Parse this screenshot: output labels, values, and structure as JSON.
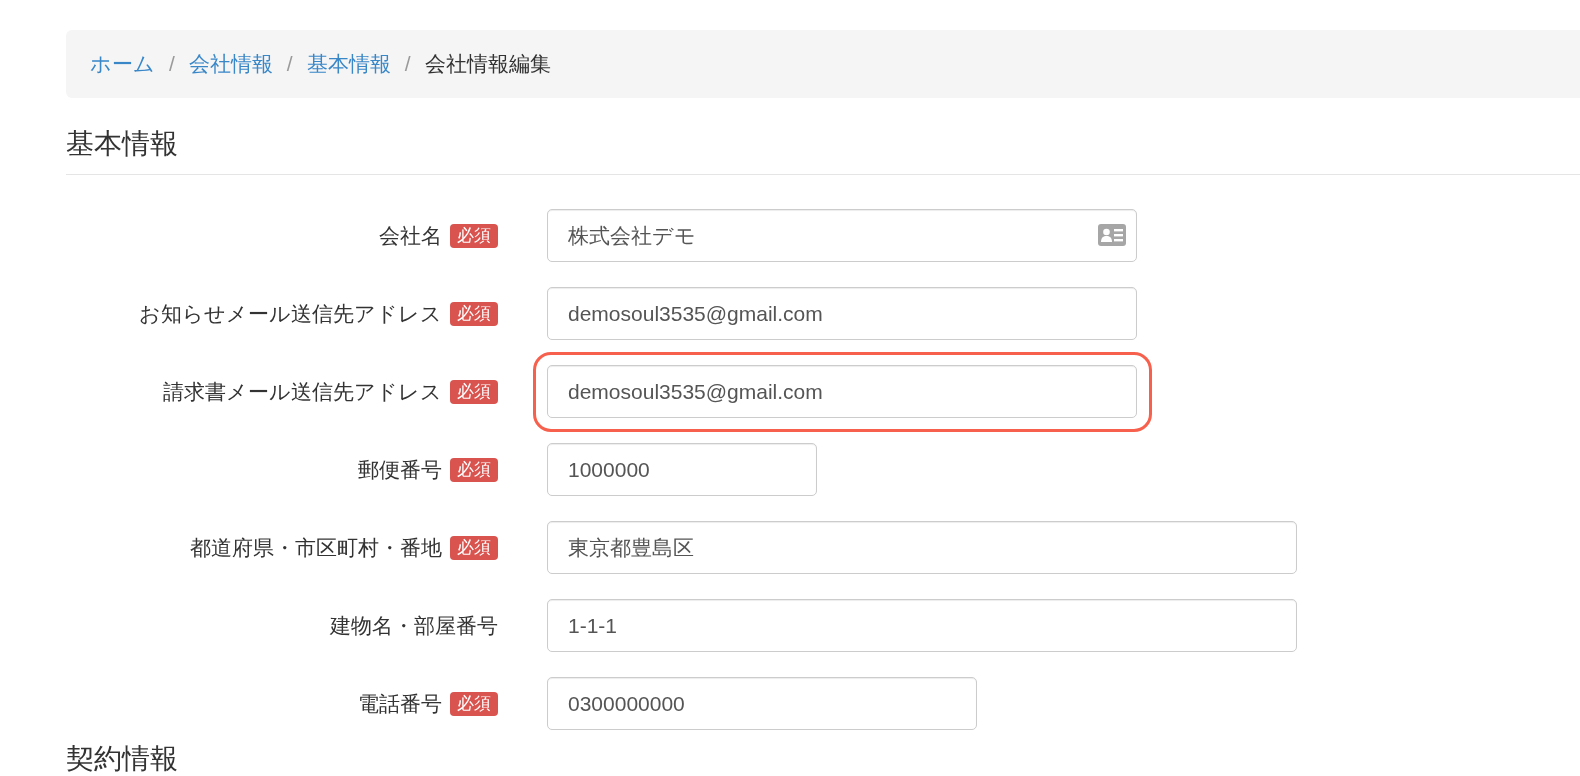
{
  "breadcrumb": {
    "items": [
      {
        "label": "ホーム",
        "current": false
      },
      {
        "label": "会社情報",
        "current": false
      },
      {
        "label": "基本情報",
        "current": false
      },
      {
        "label": "会社情報編集",
        "current": true
      }
    ],
    "separators": [
      "/",
      "/",
      "/"
    ]
  },
  "section_title": "基本情報",
  "fields": [
    {
      "label": "会社名",
      "badge": "必須",
      "value": "株式会社デモ",
      "kind": "card",
      "highlighted": false
    },
    {
      "label": "お知らせメール送信先アドレス",
      "badge": "必須",
      "value": "demosoul3535@gmail.com",
      "kind": "plain",
      "highlighted": false
    },
    {
      "label": "請求書メール送信先アドレス",
      "badge": "必須",
      "value": "demosoul3535@gmail.com",
      "kind": "plain",
      "highlighted": true
    },
    {
      "label": "郵便番号",
      "badge": "必須",
      "value": "1000000",
      "kind": "plain",
      "highlighted": false
    },
    {
      "label": "都道府県・市区町村・番地",
      "badge": "必須",
      "value": "東京都豊島区",
      "kind": "plain",
      "highlighted": false
    },
    {
      "label": "建物名・部屋番号",
      "value": "1-1-1",
      "kind": "plain",
      "highlighted": false
    },
    {
      "label": "電話番号",
      "badge": "必須",
      "value": "0300000000",
      "kind": "plain",
      "highlighted": false
    }
  ],
  "next_section_title": "契約情報"
}
